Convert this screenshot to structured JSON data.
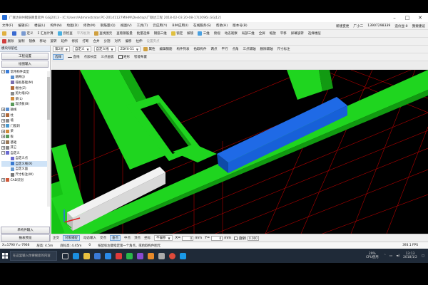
{
  "window": {
    "title": "广联达BIM钢筋算量软件 GGJ2013 - [C:\\Users\\Administrator.PC-20141127MIHM\\Desktop\\广联达工程 2018-02-03 20-08-17(2096).GGJ12]"
  },
  "menubar": {
    "items": [
      "文件(F)",
      "编辑(E)",
      "楼层(L)",
      "构件(N)",
      "绘图(D)",
      "修改(M)",
      "钢筋量(Q)",
      "视图(V)",
      "工具(T)",
      "云应用(Y)",
      "BIM应用(I)",
      "在线服务(S)",
      "帮助(H)",
      "版本号(B)"
    ],
    "new_change": "新建变更",
    "user": "广小二",
    "phone": "13907298339",
    "ask": "造价豆:0",
    "feedback": "我要建议"
  },
  "toolbar1": {
    "items": [
      "",
      "",
      "定义",
      "Σ 汇总计算",
      "云检查",
      "平齐板顶",
      "查找图元",
      "查看钢筋量",
      "批量选择",
      "钢筋三维",
      "锁定",
      "解锁",
      "",
      "三维",
      "俯视",
      "动态观察",
      "局部三维",
      "全屏",
      "缩放",
      "平移",
      "屏幕旋转",
      "选择楼层"
    ]
  },
  "toolbar2": {
    "items": [
      "删除",
      "复制",
      "镜像",
      "移动",
      "旋转",
      "延伸",
      "修剪",
      "打断",
      "合并",
      "分割",
      "对齐",
      "偏移",
      "拉伸",
      "设置夹点"
    ]
  },
  "toolbar3": {
    "floor": "第2层",
    "category": "自定义",
    "type": "自定义线",
    "element": "ZDYX-51",
    "props": "属性",
    "edit_rebar": "编辑钢筋",
    "member_list": "构件列表",
    "pick_member": "拾取构件",
    "two_point": "两点",
    "parallel": "平行",
    "point_angle": "点角",
    "three_point_aux": "三点辅轴",
    "delete_aux": "删除辅轴",
    "dim": "尺寸标注"
  },
  "toolbar4": {
    "select": "选择",
    "line": "直线",
    "point_add": "点加长度",
    "three_arc": "三点画弧",
    "rect": "矩形",
    "smart": "智能布置"
  },
  "left_panel": {
    "title": "模块导航栏",
    "btn_project": "工程设置",
    "btn_draw": "绘图输入",
    "tree": [
      {
        "label": "常用构件类型",
        "exp": "-",
        "color": "#3b7dd8",
        "indent": 0
      },
      {
        "label": "轴网(J)",
        "exp": "",
        "color": "#5a8fd0",
        "indent": 1
      },
      {
        "label": "筏板基础(M)",
        "exp": "",
        "color": "#7a6fb0",
        "indent": 1
      },
      {
        "label": "框柱(Z)",
        "exp": "",
        "color": "#b06a3a",
        "indent": 1
      },
      {
        "label": "剪力墙(Q)",
        "exp": "",
        "color": "#8a8a8a",
        "indent": 1
      },
      {
        "label": "梁(L)",
        "exp": "",
        "color": "#d08a3a",
        "indent": 1
      },
      {
        "label": "现浇板(B)",
        "exp": "",
        "color": "#5a9a5a",
        "indent": 1
      },
      {
        "label": "轴线",
        "exp": "+",
        "color": "#5a8fd0",
        "indent": 0
      },
      {
        "label": "柱",
        "exp": "+",
        "color": "#b06a3a",
        "indent": 0
      },
      {
        "label": "墙",
        "exp": "+",
        "color": "#8a8a8a",
        "indent": 0
      },
      {
        "label": "门窗洞",
        "exp": "+",
        "color": "#4a9ad0",
        "indent": 0
      },
      {
        "label": "梁",
        "exp": "+",
        "color": "#d08a3a",
        "indent": 0
      },
      {
        "label": "板",
        "exp": "+",
        "color": "#5a9a5a",
        "indent": 0
      },
      {
        "label": "基础",
        "exp": "+",
        "color": "#9a7a5a",
        "indent": 0
      },
      {
        "label": "其它",
        "exp": "+",
        "color": "#888888",
        "indent": 0
      },
      {
        "label": "自定义",
        "exp": "-",
        "color": "#6a6ad0",
        "indent": 0
      },
      {
        "label": "自定义点",
        "exp": "",
        "color": "#6a6ad0",
        "indent": 1
      },
      {
        "label": "自定义线(X)",
        "exp": "",
        "color": "#3a7ad0",
        "indent": 1
      },
      {
        "label": "自定义面",
        "exp": "",
        "color": "#6a9ad0",
        "indent": 1
      },
      {
        "label": "尺寸标注(W)",
        "exp": "",
        "color": "#7a7a7a",
        "indent": 1
      },
      {
        "label": "CAD识别",
        "exp": "+",
        "color": "#d05a3a",
        "indent": 0
      }
    ],
    "btn_single": "单构件输入",
    "btn_report": "报表预览"
  },
  "bottom_toolbar": {
    "ortho": "正交",
    "snap": "对象捕捉",
    "dyn_input": "动态输入",
    "intersect": "交点",
    "vertical": "垂点",
    "midpoint": "中点",
    "top": "顶点",
    "coord": "坐标",
    "no_offset": "不偏移",
    "x_label": "X=",
    "x_val": "0",
    "mm1": "mm",
    "y_label": "Y=",
    "y_val": "0",
    "mm2": "mm",
    "rotate": "旋转",
    "rot_val": "0.000"
  },
  "statusbar": {
    "coords": "X=1790 Y=-7966",
    "floor_h": "层高: 4.5m",
    "elev": "底标高: 4.45m",
    "count": "0",
    "hint": "按鼠标左键指定第一个角点，或拾取构件图元",
    "fps": "393.1 FPS"
  },
  "taskbar": {
    "search": "在这里输入你要搜索的内容",
    "cpu_pct": "29%",
    "cpu_label": "CPU使用",
    "time": "13:13",
    "date": "2018/1/2"
  },
  "colors": {
    "green": "#1fd51f",
    "blue": "#1760d8",
    "gray_beam": "#e8e8e8",
    "red_grid": "#c80000"
  }
}
